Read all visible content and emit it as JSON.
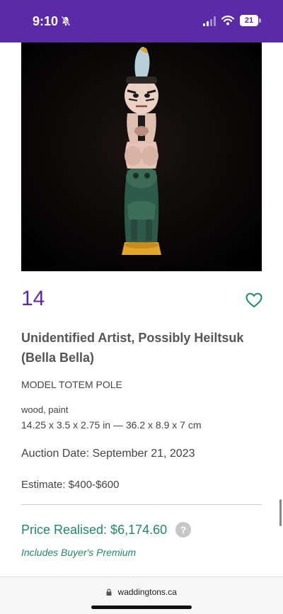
{
  "status_bar": {
    "time": "9:10",
    "battery_level": "21",
    "icons": [
      "bell-slash-icon",
      "signal-icon",
      "wifi-icon",
      "battery-icon"
    ],
    "background_color": "#5b2aa6"
  },
  "lot": {
    "number": "14",
    "artist": "Unidentified Artist, Possibly Heiltsuk (Bella Bella)",
    "title": "MODEL TOTEM POLE",
    "medium": "wood, paint",
    "dimensions": "14.25 x 3.5 x 2.75 in — 36.2 x 8.9 x 7 cm",
    "auction_date": "Auction Date: September 21, 2023",
    "estimate": "Estimate: $400-$600",
    "price_realised": "Price Realised: $6,174.60",
    "premium_note": "Includes Buyer's Premium",
    "help_glyph": "?"
  },
  "browser": {
    "url": "waddingtons.ca"
  },
  "colors": {
    "brand_purple": "#5b2aa6",
    "price_green": "#1f8a64"
  }
}
